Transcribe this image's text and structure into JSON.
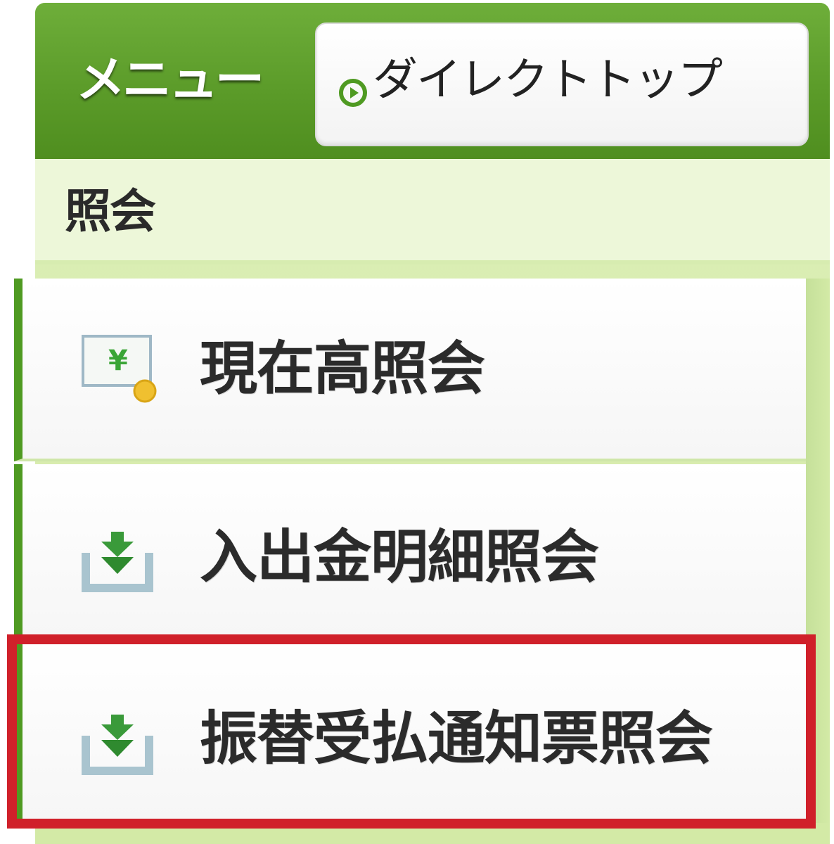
{
  "header": {
    "title": "メニュー",
    "direct_top": {
      "label": "ダイレクトトップ",
      "icon": "play-circle-icon"
    }
  },
  "category": {
    "label": "照会"
  },
  "items": [
    {
      "label": "現在高照会",
      "icon": "yen-balance-icon"
    },
    {
      "label": "入出金明細照会",
      "icon": "download-tray-icon"
    },
    {
      "label": "振替受払通知票照会",
      "icon": "download-tray-icon"
    }
  ],
  "colors": {
    "header_green": "#5a9a28",
    "highlight_red": "#d0202a",
    "panel_light_green": "#ddefb9"
  }
}
